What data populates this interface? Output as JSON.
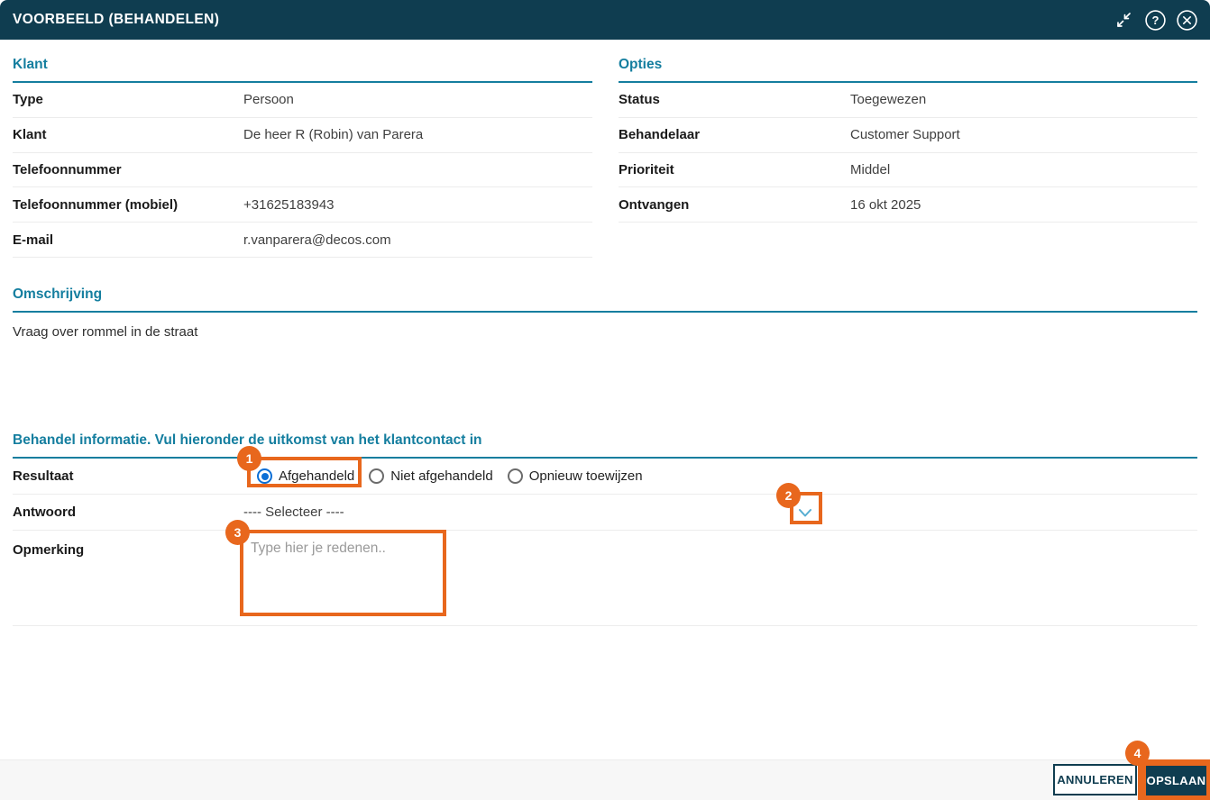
{
  "window": {
    "title": "VOORBEELD (BEHANDELEN)"
  },
  "klant": {
    "header": "Klant",
    "rows": [
      {
        "label": "Type",
        "value": "Persoon"
      },
      {
        "label": "Klant",
        "value": "De heer R (Robin) van Parera"
      },
      {
        "label": "Telefoonnummer",
        "value": ""
      },
      {
        "label": "Telefoonnummer (mobiel)",
        "value": "+31625183943"
      },
      {
        "label": "E-mail",
        "value": "r.vanparera@decos.com"
      }
    ]
  },
  "opties": {
    "header": "Opties",
    "rows": [
      {
        "label": "Status",
        "value": "Toegewezen"
      },
      {
        "label": "Behandelaar",
        "value": "Customer Support"
      },
      {
        "label": "Prioriteit",
        "value": "Middel"
      },
      {
        "label": "Ontvangen",
        "value": "16 okt 2025"
      }
    ]
  },
  "omschrijving": {
    "header": "Omschrijving",
    "text": "Vraag over rommel in de straat"
  },
  "behandel": {
    "header": "Behandel informatie. Vul hieronder de uitkomst van het klantcontact in",
    "resultaat": {
      "label": "Resultaat",
      "options": [
        {
          "label": "Afgehandeld",
          "selected": true
        },
        {
          "label": "Niet afgehandeld",
          "selected": false
        },
        {
          "label": "Opnieuw toewijzen",
          "selected": false
        }
      ]
    },
    "antwoord": {
      "label": "Antwoord",
      "value": "---- Selecteer ----"
    },
    "opmerking": {
      "label": "Opmerking",
      "placeholder": "Type hier je redenen.."
    }
  },
  "footer": {
    "annuleren": "ANNULEREN",
    "opslaan": "OPSLAAN"
  },
  "annotations": {
    "badge1": "1",
    "badge2": "2",
    "badge3": "3",
    "badge4": "4"
  },
  "colors": {
    "titlebar": "#0F3D50",
    "section_header": "#147E9F",
    "highlight_orange": "#E8671D",
    "radio_selected_blue": "#0B6FD6",
    "chevron_blue": "#56ADD2"
  }
}
